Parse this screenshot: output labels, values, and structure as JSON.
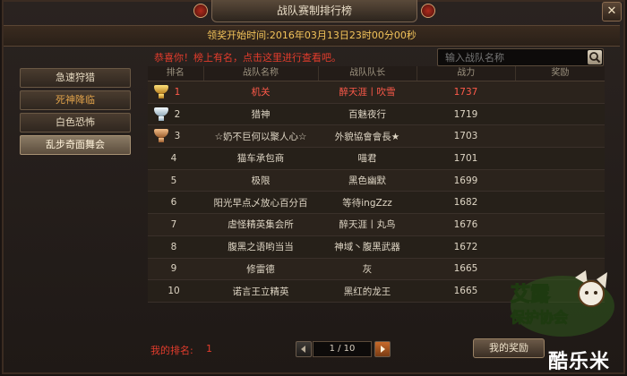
{
  "window": {
    "title": "战队赛制排行榜",
    "close_label": "✕",
    "start_time": "领奖开始时间:2016年03月13日23时00分00秒"
  },
  "sidebar": {
    "items": [
      {
        "label": "急速狩猎",
        "style": "normal"
      },
      {
        "label": "死神降临",
        "style": "orange"
      },
      {
        "label": "白色恐怖",
        "style": "normal"
      },
      {
        "label": "乱步奇面舞会",
        "style": "active"
      }
    ]
  },
  "notice": "恭喜你！榜上有名，点击这里进行查看吧。",
  "search": {
    "placeholder": "输入战队名称",
    "value": ""
  },
  "table": {
    "headers": [
      "排名",
      "战队名称",
      "战队队长",
      "战力",
      "奖励"
    ],
    "rows": [
      {
        "rank": "1",
        "name": "机关",
        "captain": "醉天涯丨吹雪",
        "power": "1737",
        "medal": "gold"
      },
      {
        "rank": "2",
        "name": "猎神",
        "captain": "百魅夜行",
        "power": "1719",
        "medal": "silver"
      },
      {
        "rank": "3",
        "name": "☆奶不巨何以聚人心☆",
        "captain": "外貌協會會長★",
        "power": "1703",
        "medal": "bronze"
      },
      {
        "rank": "4",
        "name": "猫车承包商",
        "captain": "喵君",
        "power": "1701",
        "medal": ""
      },
      {
        "rank": "5",
        "name": "极限",
        "captain": "黑色幽默",
        "power": "1699",
        "medal": ""
      },
      {
        "rank": "6",
        "name": "阳光早点乄放心百分百",
        "captain": "等待ingZzz",
        "power": "1682",
        "medal": ""
      },
      {
        "rank": "7",
        "name": "虐怪精英集会所",
        "captain": "醉天涯丨丸鸟",
        "power": "1676",
        "medal": ""
      },
      {
        "rank": "8",
        "name": "腹黑之语哟当当",
        "captain": "神域丶腹黑武器",
        "power": "1672",
        "medal": ""
      },
      {
        "rank": "9",
        "name": "修雷德",
        "captain": "灰",
        "power": "1665",
        "medal": ""
      },
      {
        "rank": "10",
        "name": "诺言王立精英",
        "captain": "黑红的龙王",
        "power": "1665",
        "medal": ""
      }
    ]
  },
  "footer": {
    "my_rank_label": "我的排名:",
    "my_rank_value": "1",
    "page": "1 / 10",
    "reward_button": "我的奖励"
  },
  "branding": {
    "logo_line1": "艾露",
    "logo_line2": "保护协会",
    "watermark": "酷乐米"
  },
  "colors": {
    "accent_red": "#e23c2c",
    "gold_text": "#f2c35a"
  }
}
